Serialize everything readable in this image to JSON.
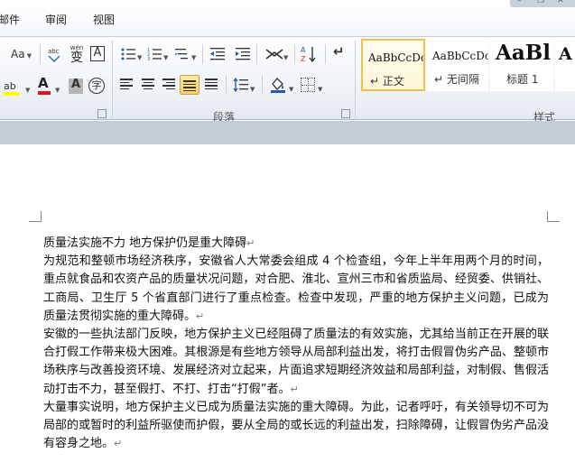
{
  "menu": {
    "tabs": [
      "邮件",
      "审阅",
      "视图"
    ]
  },
  "window_controls": [
    "–",
    "❐",
    "✕"
  ],
  "ribbon": {
    "font_group": {
      "change_case": "Aa",
      "phonetic": "wén",
      "char_border": "A",
      "highlight": "ab",
      "font_color": "A",
      "char_shading": "A",
      "enclose": "字"
    },
    "paragraph_group": {
      "label": "段落",
      "sort": "A↓Z",
      "show_marks": "↵"
    },
    "styles_group": {
      "label": "样式",
      "items": [
        {
          "preview": "AaBbCcDc",
          "name": "↵ 正文",
          "selected": true
        },
        {
          "preview": "AaBbCcDc",
          "name": "↵ 无间隔",
          "selected": false
        },
        {
          "preview": "AaBl",
          "name": "标题 1",
          "selected": false
        },
        {
          "preview": "A",
          "name": "",
          "selected": false
        }
      ]
    }
  },
  "document": {
    "title": "质量法实施不力  地方保护仍是重大障碍",
    "paragraphs": [
      "为规范和整顿市场经济秩序，安徽省人大常委会组成 4 个检查组，今年上半年用两个月的时间，重点就食品和农资产品的质量状况问题，对合肥、淮北、宣州三市和省质监局、经贸委、供销社、工商局、卫生厅 5 个省直部门进行了重点检查。检查中发现，严重的地方保护主义问题，已成为质量法贯彻实施的重大障碍。",
      "安徽的一些执法部门反映，地方保护主义已经阻碍了质量法的有效实施，尤其给当前正在开展的联合打假工作带来极大困难。其根源是有些地方领导从局部利益出发，将打击假冒伪劣产品、整顿市场秩序与改善投资环境、发展经济对立起来，片面追求短期经济效益和局部利益，对制假、售假活动打击不力，甚至假打、不打、打击“打假”者。",
      "大量事实说明，地方保护主义已成为质量法实施的重大障碍。为此，记者呼吁，有关领导切不可为局部的或暂时的利益所驱使而护假，要从全局的或长远的利益出发，扫除障碍，让假冒伪劣产品没有容身之地。"
    ],
    "paragraph_mark": "↵"
  }
}
